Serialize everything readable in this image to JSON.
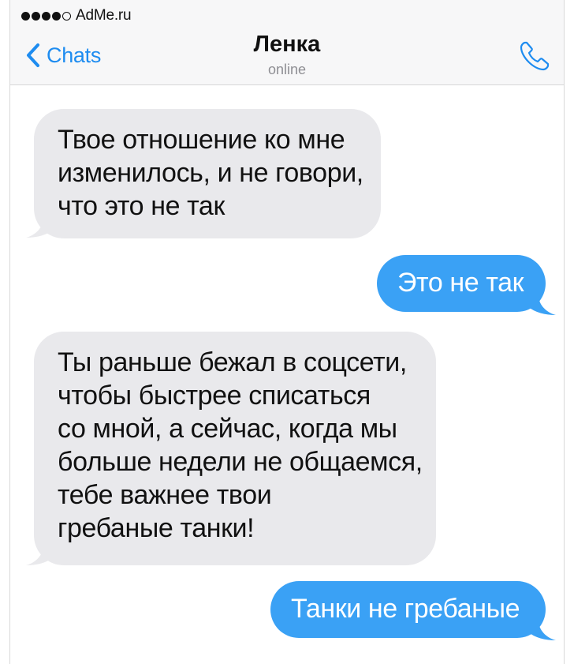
{
  "status_bar": {
    "signal": [
      "filled",
      "filled",
      "filled",
      "filled",
      "empty"
    ],
    "carrier": "AdMe.ru"
  },
  "nav": {
    "back_label": "Chats",
    "contact_name": "Ленка",
    "contact_status": "online",
    "call_icon": "phone-icon"
  },
  "messages": [
    {
      "direction": "incoming",
      "lines": [
        "Твое отношение ко мне",
        "изменилось, и не говори,",
        "что это не так"
      ]
    },
    {
      "direction": "outgoing",
      "text": "Это не так"
    },
    {
      "direction": "incoming",
      "lines": [
        "Ты раньше бежал в соцсети,",
        "чтобы быстрее списаться",
        "со мной, а сейчас, когда мы",
        "больше недели не общаемся,",
        "тебе важнее твои",
        "гребаные танки!"
      ]
    },
    {
      "direction": "outgoing",
      "text": "Танки не гребаные"
    }
  ],
  "colors": {
    "accent": "#1e8cf0",
    "outgoing_bubble": "#3aa1f5",
    "incoming_bubble": "#e9e9ec",
    "header_bg": "#f7f7f8"
  }
}
